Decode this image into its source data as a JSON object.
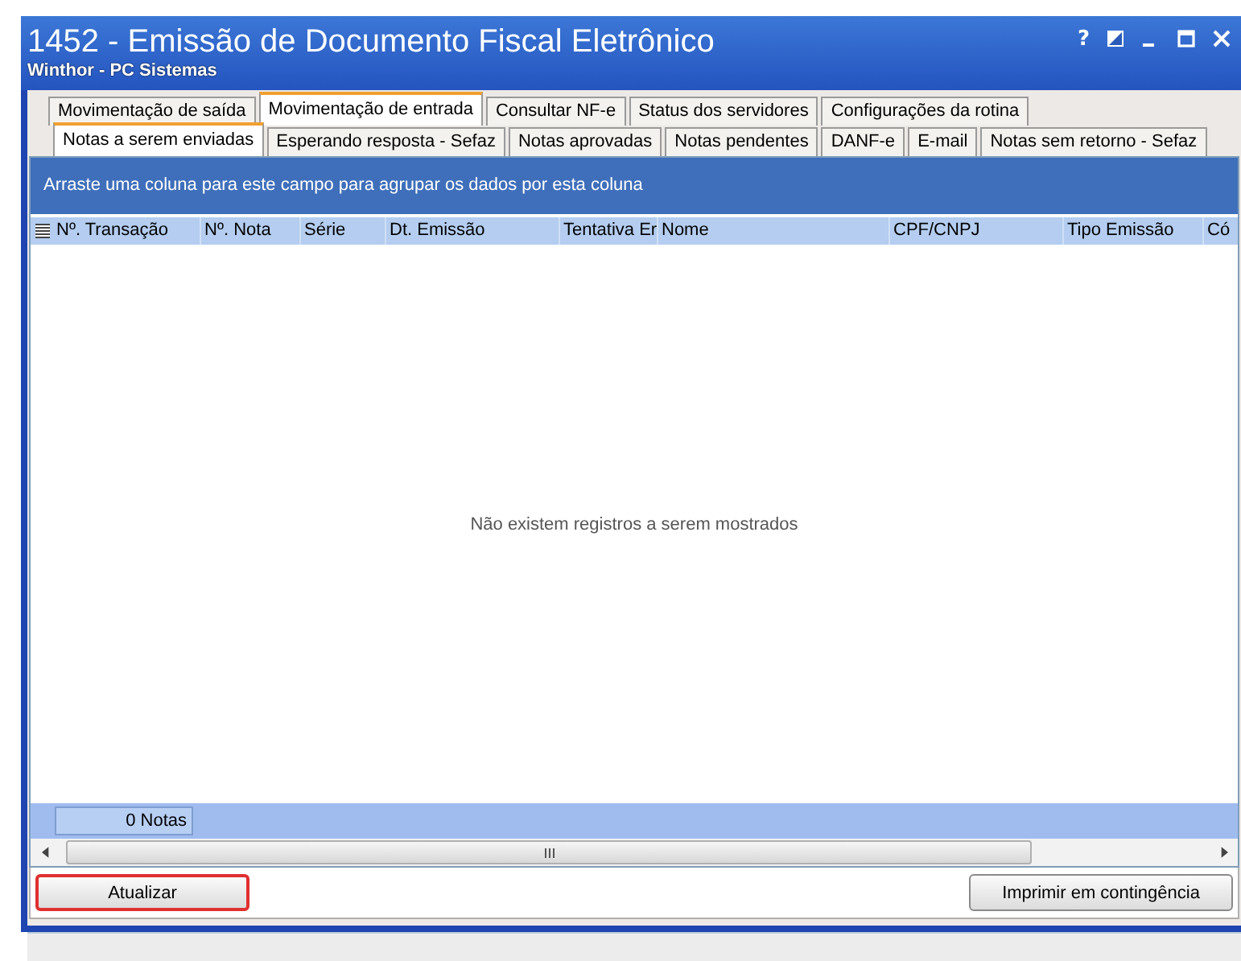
{
  "window": {
    "title": "1452 - Emissão de Documento Fiscal Eletrônico",
    "subtitle": "Winthor - PC Sistemas",
    "controls": [
      "?"
    ]
  },
  "tabs": [
    {
      "label": "Movimentação de saída",
      "selected": false
    },
    {
      "label": "Movimentação de entrada",
      "selected": true
    },
    {
      "label": "Consultar NF-e",
      "selected": false
    },
    {
      "label": "Status dos servidores",
      "selected": false
    },
    {
      "label": "Configurações da rotina",
      "selected": false
    }
  ],
  "subtabs": [
    {
      "label": "Notas a serem enviadas",
      "selected": true
    },
    {
      "label": "Esperando resposta - Sefaz",
      "selected": false
    },
    {
      "label": "Notas aprovadas",
      "selected": false
    },
    {
      "label": "Notas pendentes",
      "selected": false
    },
    {
      "label": "DANF-e",
      "selected": false
    },
    {
      "label": "E-mail",
      "selected": false
    },
    {
      "label": "Notas sem retorno - Sefaz",
      "selected": false
    }
  ],
  "grid": {
    "group_hint": "Arraste uma coluna para este campo para agrupar os dados por esta coluna",
    "columns": [
      "Nº. Transação",
      "Nº. Nota",
      "Série",
      "Dt. Emissão",
      "Tentativa Er",
      "Nome",
      "CPF/CNPJ",
      "Tipo Emissão",
      "Có"
    ],
    "empty_message": "Não existem registros a serem mostrados",
    "footer_count": "0 Notas"
  },
  "buttons": [
    {
      "label": "Atualizar",
      "highlighted": true
    },
    {
      "label": "Imprimir em contingência",
      "highlighted": false
    }
  ]
}
